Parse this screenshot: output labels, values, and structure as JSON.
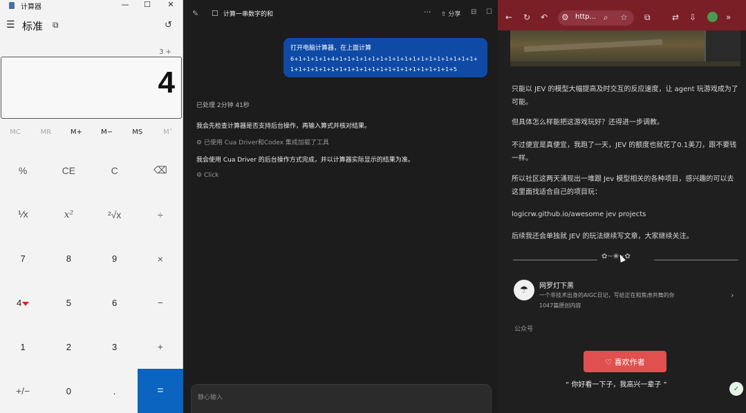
{
  "calculator": {
    "title": "计算器",
    "window_controls": [
      "—",
      "☐",
      "✕"
    ],
    "menu_icon": "☰",
    "mode": "标准",
    "keep_on_top_icon": "⧉",
    "history_icon": "↺",
    "expression": "3 +",
    "result": "4",
    "memory_buttons": [
      {
        "label": "MC",
        "enabled": false
      },
      {
        "label": "MR",
        "enabled": false
      },
      {
        "label": "M+",
        "enabled": true
      },
      {
        "label": "M−",
        "enabled": true
      },
      {
        "label": "MS",
        "enabled": true
      },
      {
        "label": "M˅",
        "enabled": false
      }
    ],
    "keys": [
      [
        "%",
        "CE",
        "C",
        "⌫"
      ],
      [
        "⅟x",
        "x²",
        "²√x",
        "÷"
      ],
      [
        "7",
        "8",
        "9",
        "×"
      ],
      [
        "4",
        "5",
        "6",
        "−"
      ],
      [
        "1",
        "2",
        "3",
        "+"
      ],
      [
        "+/−",
        "0",
        ".",
        "="
      ]
    ]
  },
  "chat": {
    "title": "计算一串数字的和",
    "edit_icon": "✎",
    "doc_icon": "☐",
    "more_icon": "···",
    "share_label": "⇧ 分享",
    "layout_icon": "⊟",
    "max_icon": "☐",
    "user_message": {
      "line1": "打开电脑计算器，在上面计算",
      "line2": "6+1+1+1+1+4+1+1+1+1+1+1+1+1+1+1+1+1+1+1+1+1+1+1+1+1+1+1+1+1+1+1+1+1+1+1+1+1+1+1+1+1+1+5"
    },
    "elapsed": "已处理 2分钟 41秒",
    "lines": [
      "我会先检查计算器是否支持后台操作，再输入算式并核对结果。",
      "已使用 Cua Driver和Codex 集成加载了工具",
      "我会使用 Cua Driver 的后台操作方式完成，并以计算器实际显示的结果为准。",
      "Click"
    ],
    "input_placeholder": "静心输入"
  },
  "browser": {
    "nav_icons": [
      "←",
      "↻",
      "↶",
      "⚙"
    ],
    "url": "http...",
    "toolbar_icons": [
      "⌕",
      "☆",
      "⧉",
      "⇄",
      "⇩",
      "»"
    ],
    "article_paragraphs": [
      "只能以 JEV 的模型大幅提高及时交互的反应速度，让 agent 玩游戏成为了可能。",
      "但具体怎么样能把这游戏玩好？还得进一步调教。",
      "不过便宜是真便宜，我跑了一天，JEV 的额度也就花了0.1美刀，跟不要钱一样。",
      "所以社区这两天涌现出一堆跟 Jev 模型相关的各种项目，感兴趣的可以去这里面找适合自己的项目玩：",
      "logicrw.github.io/awesome jev projects",
      "后续我还会单独就 JEV 的玩法继续写文章，大家继续关注。"
    ],
    "divider_ornament": "✿~❀~✿",
    "author": {
      "avatar_icon": "☂",
      "name": "网罗灯下黑",
      "desc": "一个非技术出身的AIGC日记，写给正在和焦虑共舞的你",
      "count": "1047篇原创内容"
    },
    "account_type": "公众号",
    "like_button": "♡ 喜欢作者",
    "quote": "“ 你好看一下子，我高兴一辈子 ”",
    "float_badge": "✓"
  }
}
